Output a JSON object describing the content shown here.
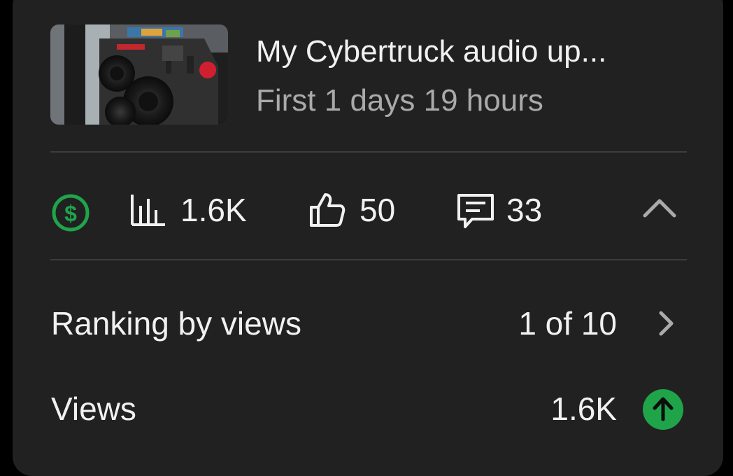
{
  "colors": {
    "card_background": "#212121",
    "primary_text": "#f1f1f1",
    "secondary_text": "#aaaaaa",
    "divider": "#3d3d3d",
    "accent_green": "#1fa44a"
  },
  "video": {
    "title": "My Cybertruck audio up...",
    "subtitle": "First 1 days 19 hours",
    "thumbnail_icon": "subwoofer-box-thumbnail"
  },
  "stats": {
    "monetization_icon": "dollar-circle-icon",
    "views_icon": "bar-chart-icon",
    "views": "1.6K",
    "likes_icon": "thumbs-up-icon",
    "likes": "50",
    "comments_icon": "comment-icon",
    "comments": "33",
    "collapse_icon": "chevron-up-icon"
  },
  "details": {
    "ranking_label": "Ranking by views",
    "ranking_value": "1 of 10",
    "views_label": "Views",
    "views_value": "1.6K",
    "views_trend_icon": "arrow-up-icon"
  }
}
